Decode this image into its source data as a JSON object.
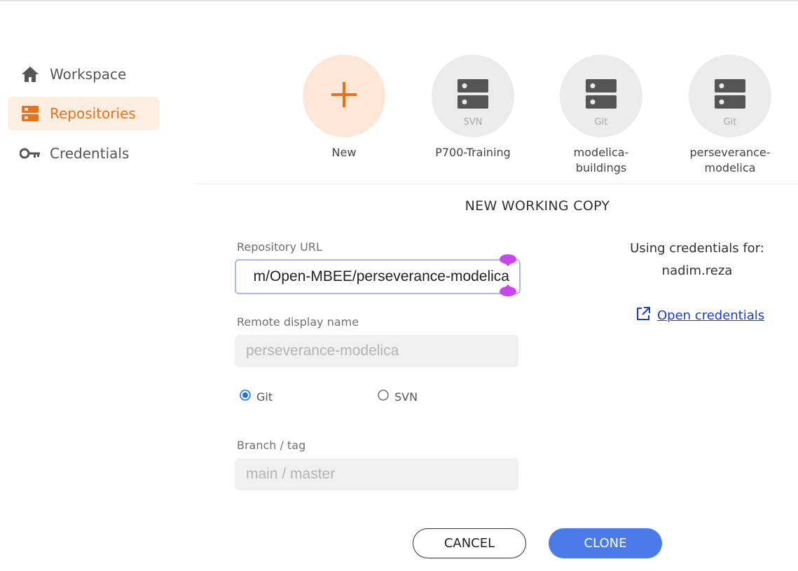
{
  "sidebar": {
    "items": [
      {
        "label": "Workspace",
        "icon": "home-icon"
      },
      {
        "label": "Repositories",
        "icon": "server-icon",
        "active": true
      },
      {
        "label": "Credentials",
        "icon": "key-icon"
      }
    ]
  },
  "repos": [
    {
      "name": "New",
      "type": "",
      "icon": "plus-icon"
    },
    {
      "name": "P700-Training",
      "type": "SVN",
      "icon": "server-icon"
    },
    {
      "name": "modelica-buildings",
      "type": "Git",
      "icon": "server-icon"
    },
    {
      "name": "perseverance-\nmodelica",
      "type": "Git",
      "icon": "server-icon"
    }
  ],
  "form": {
    "title": "NEW WORKING COPY",
    "repo_url_label": "Repository URL",
    "repo_url_value": "m/Open-MBEE/perseverance-modelica",
    "remote_name_label": "Remote display name",
    "remote_name_placeholder": "perseverance-modelica",
    "vcs_options": [
      "Git",
      "SVN"
    ],
    "vcs_selected": "Git",
    "branch_label": "Branch / tag",
    "branch_placeholder": "main / master"
  },
  "credentials": {
    "line1": "Using credentials for:",
    "user": "nadim.reza",
    "link_label": "Open credentials"
  },
  "actions": {
    "cancel_label": "CANCEL",
    "clone_label": "CLONE"
  },
  "colors": {
    "accent": "#e8711d",
    "accent_bg": "#fdeee2",
    "primary": "#4a7be8",
    "link": "#1a3ccf",
    "selection_handle": "#c845f0"
  }
}
